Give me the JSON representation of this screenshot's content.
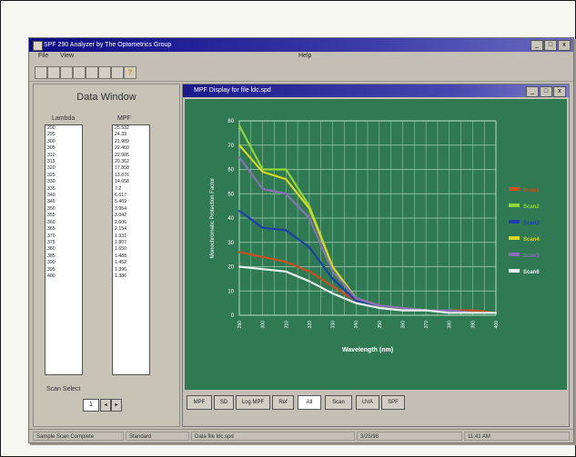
{
  "window": {
    "title": "SPF 290 Analyzer by The Optometrics Group",
    "caption_buttons": [
      "_",
      "□",
      "x"
    ]
  },
  "menubar": {
    "items": [
      "File",
      "View"
    ],
    "help": "Help"
  },
  "toolbar": {
    "buttons": [
      "open-icon",
      "save-icon",
      "print-icon",
      "cut-icon",
      "copy-icon",
      "paste-icon",
      "scan-icon",
      "help-icon"
    ],
    "help_glyph": "?"
  },
  "data_window": {
    "title": "Data Window",
    "col1_header": "Lambda",
    "col2_header": "MPF",
    "lambda": [
      "290",
      "295",
      "300",
      "305",
      "310",
      "315",
      "320",
      "325",
      "330",
      "335",
      "340",
      "345",
      "350",
      "355",
      "360",
      "365",
      "370",
      "375",
      "380",
      "385",
      "390",
      "395",
      "400"
    ],
    "mpf": [
      "25.532",
      "24.33",
      "21.989",
      "22.460",
      "22.985",
      "20.362",
      "17.858",
      "13.876",
      "14.658",
      "7.2",
      "6.617",
      "5.469",
      "3.954",
      "3.042",
      "2.606",
      "2.154",
      "1.931",
      "1.807",
      "1.650",
      "1.488",
      "1.452",
      "1.396",
      "1.386"
    ],
    "scan_select_label": "Scan Select",
    "scan_value": "1"
  },
  "plot_window": {
    "title": "MPF Display for file ldc.spd",
    "buttons": {
      "mpf": "MPF",
      "sd": "SD",
      "log_mpf": "Log MPF",
      "ref": "Ref",
      "all_value": "All",
      "scan": "Scan",
      "uva": "UVA",
      "spf": "SPF"
    }
  },
  "chart_data": {
    "type": "line",
    "xlabel": "Wavelength (nm)",
    "ylabel": "Monochromatic Protection Factor",
    "ylim": [
      0,
      80
    ],
    "y_ticks": [
      0,
      10,
      20,
      30,
      40,
      50,
      60,
      70,
      80
    ],
    "x": [
      290,
      300,
      310,
      320,
      330,
      340,
      350,
      360,
      370,
      380,
      390,
      400
    ],
    "x_tick_labels": [
      "290",
      "300",
      "310",
      "320",
      "330",
      "340",
      "350",
      "360",
      "370",
      "380",
      "390",
      "400"
    ],
    "grid": true,
    "legend_position": "right",
    "series": [
      {
        "name": "Scan1",
        "color": "#c8501e",
        "values": [
          26,
          24,
          22,
          18,
          12,
          6,
          4,
          3,
          2,
          2,
          2,
          1
        ]
      },
      {
        "name": "Scan2",
        "color": "#8fd63a",
        "values": [
          78,
          60,
          60,
          45,
          20,
          7,
          4,
          3,
          2,
          2,
          1,
          1
        ]
      },
      {
        "name": "Scan3",
        "color": "#1c3fa8",
        "values": [
          43,
          36,
          35,
          28,
          15,
          6,
          4,
          3,
          2,
          2,
          1,
          1
        ]
      },
      {
        "name": "Scan4",
        "color": "#d8d820",
        "values": [
          70,
          59,
          56,
          44,
          20,
          7,
          4,
          3,
          2,
          2,
          1,
          1
        ]
      },
      {
        "name": "Scan5",
        "color": "#8a6fb8",
        "values": [
          65,
          52,
          50,
          40,
          18,
          7,
          4,
          3,
          2,
          2,
          1,
          1
        ]
      },
      {
        "name": "Scan6",
        "color": "#e8f0ee",
        "values": [
          20,
          19,
          18,
          14,
          9,
          5,
          3,
          2,
          2,
          1,
          1,
          1
        ]
      }
    ]
  },
  "status": {
    "message": "Sample Scan Complete",
    "mode": "Standard",
    "file": "Data file ldc.spd",
    "date": "3/25/98",
    "time": "11:41 AM"
  }
}
